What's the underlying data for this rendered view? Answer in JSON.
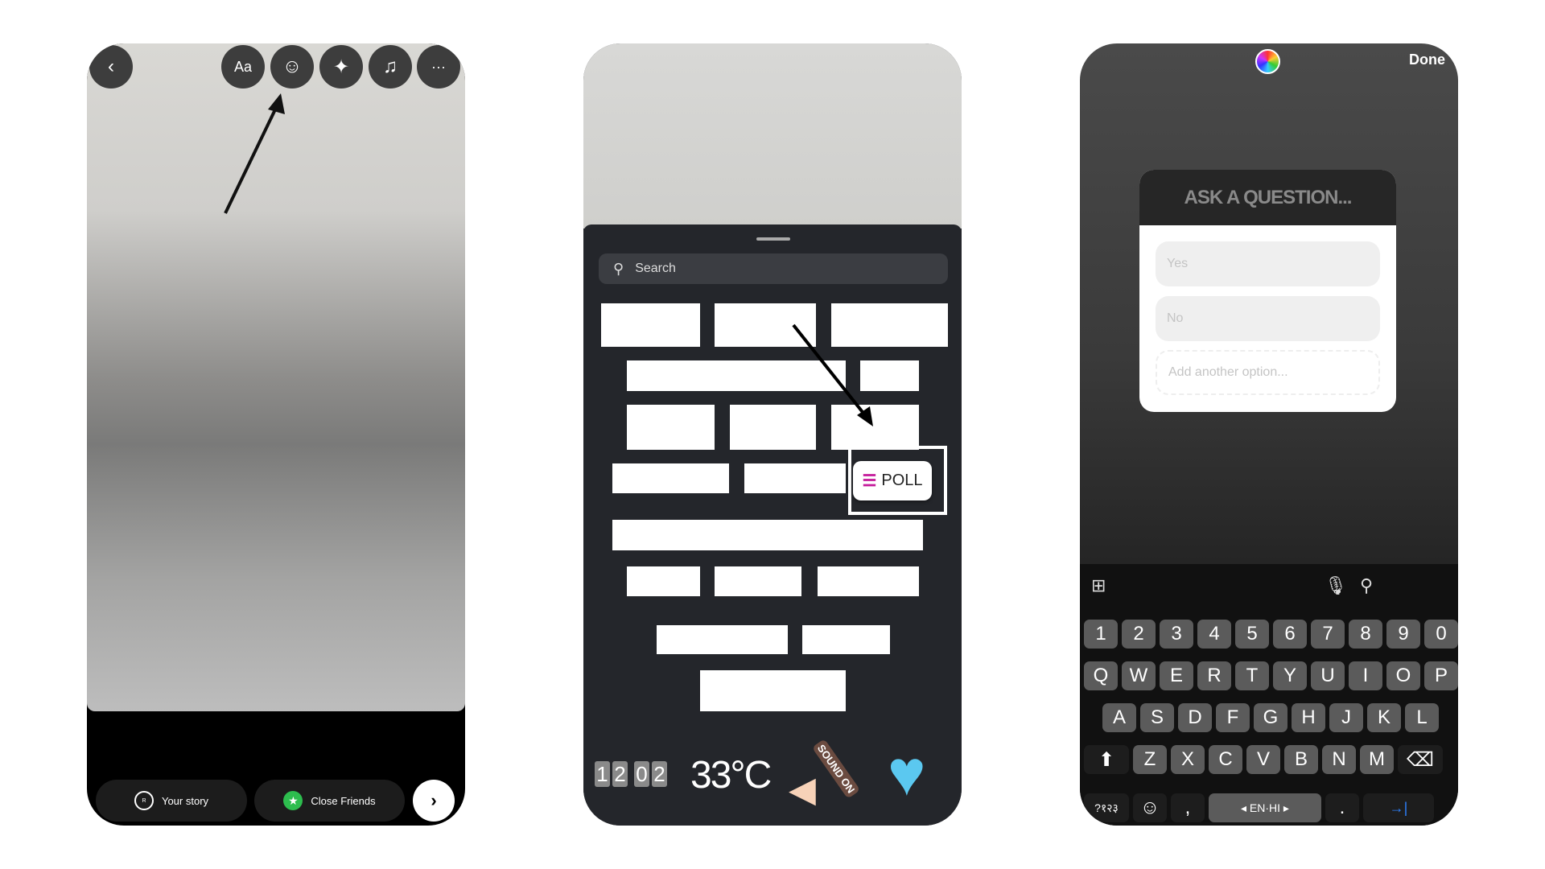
{
  "phone1": {
    "toolbar": [
      {
        "icon": "back-icon",
        "glyph": "‹"
      },
      {
        "icon": "text-icon",
        "glyph": "Aa"
      },
      {
        "icon": "sticker-icon",
        "glyph": "☺"
      },
      {
        "icon": "effects-icon",
        "glyph": "✦"
      },
      {
        "icon": "music-icon",
        "glyph": "♫"
      },
      {
        "icon": "more-icon",
        "glyph": "···"
      }
    ],
    "your_story": "Your story",
    "close_friends": "Close Friends",
    "next_glyph": "›",
    "colors": {
      "close_friends": "#2dbd4e"
    }
  },
  "phone2": {
    "search_placeholder": "Search",
    "poll_label": "POLL",
    "clock_digits": [
      "1",
      "2",
      "0",
      "2"
    ],
    "temperature": "33°C",
    "sound_on": "SOUND ON",
    "colors": {
      "sheet": "#24262b",
      "heart": "#5bc8f0",
      "poll_accent": "#c4199a"
    }
  },
  "phone3": {
    "done": "Done",
    "question_placeholder": "ASK A QUESTION...",
    "options": [
      "Yes",
      "No"
    ],
    "add_option": "Add another option...",
    "keyboard": {
      "rows": [
        [
          "1",
          "2",
          "3",
          "4",
          "5",
          "6",
          "7",
          "8",
          "9",
          "0"
        ],
        [
          "Q",
          "W",
          "E",
          "R",
          "T",
          "Y",
          "U",
          "I",
          "O",
          "P"
        ],
        [
          "A",
          "S",
          "D",
          "F",
          "G",
          "H",
          "J",
          "K",
          "L"
        ],
        [
          "Z",
          "X",
          "C",
          "V",
          "B",
          "N",
          "M"
        ]
      ],
      "symbols_key": "?१२३",
      "comma": ",",
      "space_label": "◂ EN·HI ▸",
      "period": ".",
      "enter_glyph": "→|"
    }
  }
}
